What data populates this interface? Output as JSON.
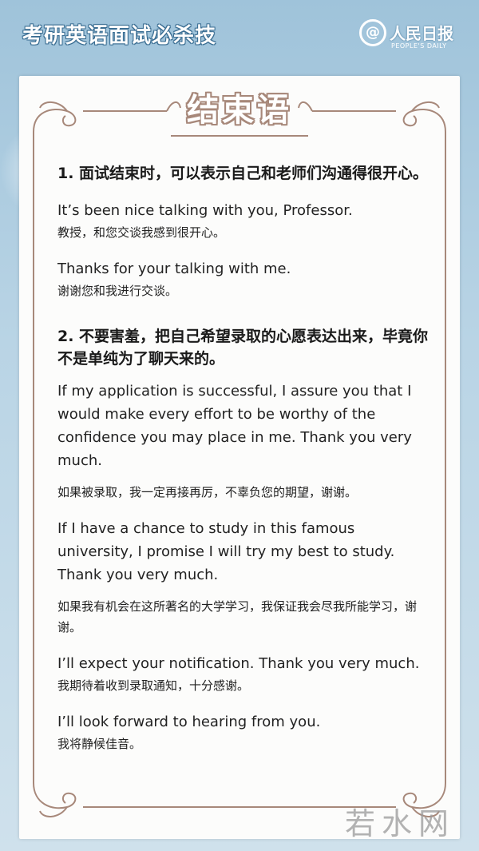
{
  "header": {
    "title": "考研英语面试必杀技",
    "logo_symbol": "@",
    "logo_cn": "人民日报",
    "logo_en": "PEOPLE'S DAILY"
  },
  "card": {
    "title": "结束语"
  },
  "sections": [
    {
      "heading": "1. 面试结束时，可以表示自己和老师们沟通得很开心。",
      "pairs": [
        {
          "en": "It’s been nice talking with you, Professor.",
          "cn": "教授，和您交谈我感到很开心。"
        },
        {
          "en": "Thanks for your talking with me.",
          "cn": "谢谢您和我进行交谈。"
        }
      ]
    },
    {
      "heading": "2. 不要害羞，把自己希望录取的心愿表达出来，毕竟你不是单纯为了聊天来的。",
      "pairs": [
        {
          "en": "If my application is successful, I assure you that I would make every effort to be worthy of the confidence you may place in me. Thank you very much.",
          "cn": "如果被录取，我一定再接再厉，不辜负您的期望，谢谢。"
        },
        {
          "en": "If I have a chance to study in this famous university, I promise I will try my best to study. Thank you very much.",
          "cn": "如果我有机会在这所著名的大学学习，我保证我会尽我所能学习，谢谢。"
        },
        {
          "en": "I’ll expect your notification. Thank you very much.",
          "cn": "我期待着收到录取通知，十分感谢。"
        },
        {
          "en": "I’ll look forward to hearing from you.",
          "cn": "我将静候佳音。"
        }
      ]
    }
  ],
  "watermark": "若水网",
  "colors": {
    "background": "#b9d4e5",
    "frame": "#a7887a",
    "card": "#fcfcfb"
  }
}
